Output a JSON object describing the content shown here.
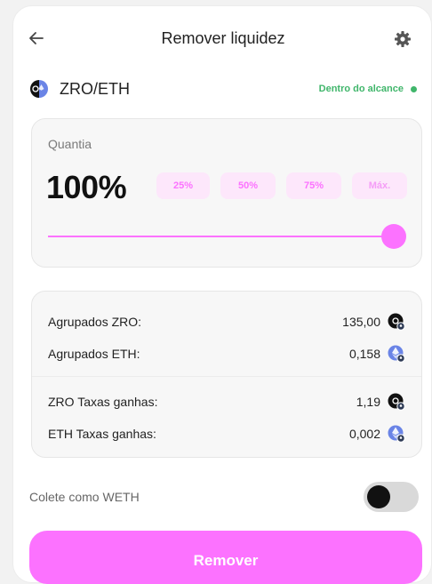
{
  "header": {
    "title": "Remover liquidez"
  },
  "pair": {
    "label": "ZRO/ETH",
    "range_status": "Dentro do alcance",
    "status_color": "#40b66b"
  },
  "amount": {
    "label": "Quantia",
    "percent": "100%",
    "percent_value": 100,
    "presets": [
      "25%",
      "50%",
      "75%",
      "Máx."
    ],
    "accent_color": "#fc72ff"
  },
  "details": [
    {
      "label": "Agrupados ZRO:",
      "value": "135,00",
      "token_icon": "zro-token-icon"
    },
    {
      "label": "Agrupados ETH:",
      "value": "0,158",
      "token_icon": "eth-token-icon"
    },
    {
      "label": "ZRO Taxas ganhas:",
      "value": "1,19",
      "token_icon": "zro-token-icon"
    },
    {
      "label": "ETH Taxas ganhas:",
      "value": "0,002",
      "token_icon": "eth-token-icon"
    }
  ],
  "weth": {
    "label": "Colete como WETH",
    "enabled": false
  },
  "actions": {
    "remove_label": "Remover"
  }
}
